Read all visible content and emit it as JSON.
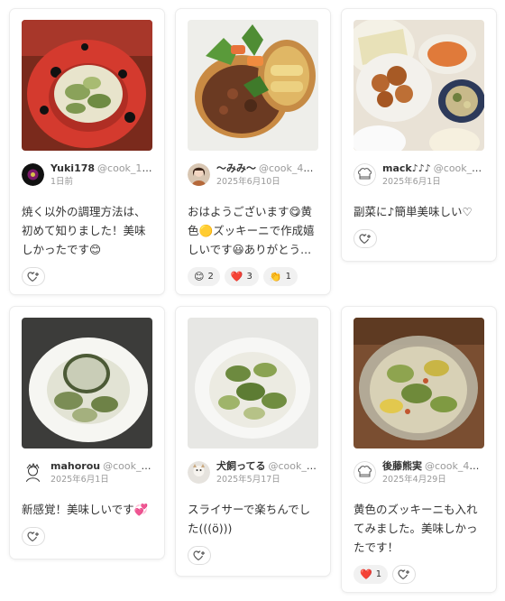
{
  "cards": [
    {
      "user_name": "Yuki178",
      "user_id": "@cook_109...",
      "date": "1日前",
      "comment": "焼く以外の調理方法は、初めて知りました！美味しかったです😊",
      "reactions": []
    },
    {
      "user_name": "〜みみ〜",
      "user_id": "@cook_40...",
      "date": "2025年6月10日",
      "comment": "おはようございます😋黄色🟡ズッキーニで作成嬉しいです😃ありがとう...",
      "reactions": [
        {
          "emoji": "😊",
          "count": "2"
        },
        {
          "emoji": "❤️",
          "count": "3"
        },
        {
          "emoji": "👏",
          "count": "1"
        }
      ]
    },
    {
      "user_name": "mack♪♪♪",
      "user_id": "@cook_40...",
      "date": "2025年6月1日",
      "comment": "副菜に♪簡単美味しい♡",
      "reactions": []
    },
    {
      "user_name": "mahorou",
      "user_id": "@cook_40...",
      "date": "2025年6月1日",
      "comment": "新感覚！美味しいです💞",
      "reactions": []
    },
    {
      "user_name": "犬飼ってる",
      "user_id": "@cook_4...",
      "date": "2025年5月17日",
      "comment": "スライサーで楽ちんでした(((ö)))",
      "reactions": []
    },
    {
      "user_name": "後藤熊実",
      "user_id": "@cook_40...",
      "date": "2025年4月29日",
      "comment": "黄色のズッキーニも入れてみました。美味しかったです！",
      "reactions": [
        {
          "emoji": "❤️",
          "count": "1"
        }
      ]
    }
  ],
  "icons": {
    "add_reaction": "heart-plus-icon",
    "chef_avatar": "chef-hat-icon"
  },
  "colors": {
    "pill_bg": "#f1f1f1",
    "muted_text": "#999999"
  }
}
